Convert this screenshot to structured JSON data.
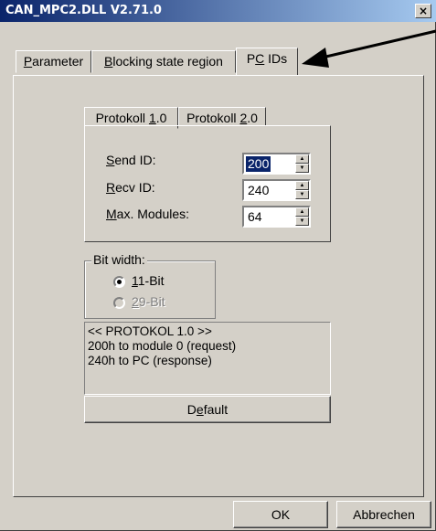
{
  "window": {
    "title": "CAN_MPC2.DLL V2.71.0",
    "close_label": "×"
  },
  "tabs": [
    {
      "pre": "",
      "key": "P",
      "post": "arameter",
      "selected": false
    },
    {
      "pre": "",
      "key": "B",
      "post": "locking state region",
      "selected": false
    },
    {
      "pre": "P",
      "key": "C",
      "post": " IDs",
      "selected": true
    }
  ],
  "subtabs": [
    {
      "pre": "Protokoll ",
      "key": "1",
      "post": ".0",
      "selected": true
    },
    {
      "pre": "Protokoll ",
      "key": "2",
      "post": ".0",
      "selected": false
    }
  ],
  "fields": [
    {
      "pre": "",
      "key": "S",
      "post": "end ID:",
      "value": "200",
      "selected": true
    },
    {
      "pre": "",
      "key": "R",
      "post": "ecv ID:",
      "value": "240",
      "selected": false
    },
    {
      "pre": "",
      "key": "M",
      "post": "ax. Modules:",
      "value": "64",
      "selected": false
    }
  ],
  "bitwidth": {
    "title": "Bit width:",
    "options": [
      {
        "pre": "",
        "key": "1",
        "post": "1-Bit",
        "checked": true,
        "enabled": true
      },
      {
        "pre": "",
        "key": "2",
        "post": "9-Bit",
        "checked": false,
        "enabled": false
      }
    ]
  },
  "info": {
    "line1": "<< PROTOKOL 1.0 >>",
    "line2": "200h to module 0 (request)",
    "line3": "240h to PC (response)"
  },
  "default_button": {
    "pre": "D",
    "key": "e",
    "post": "fault"
  },
  "ok_label": "OK",
  "cancel_label": "Abbrechen",
  "colors": {
    "titlebar_start": "#0a246a",
    "titlebar_end": "#a6caf0",
    "face": "#d4d0c8"
  }
}
